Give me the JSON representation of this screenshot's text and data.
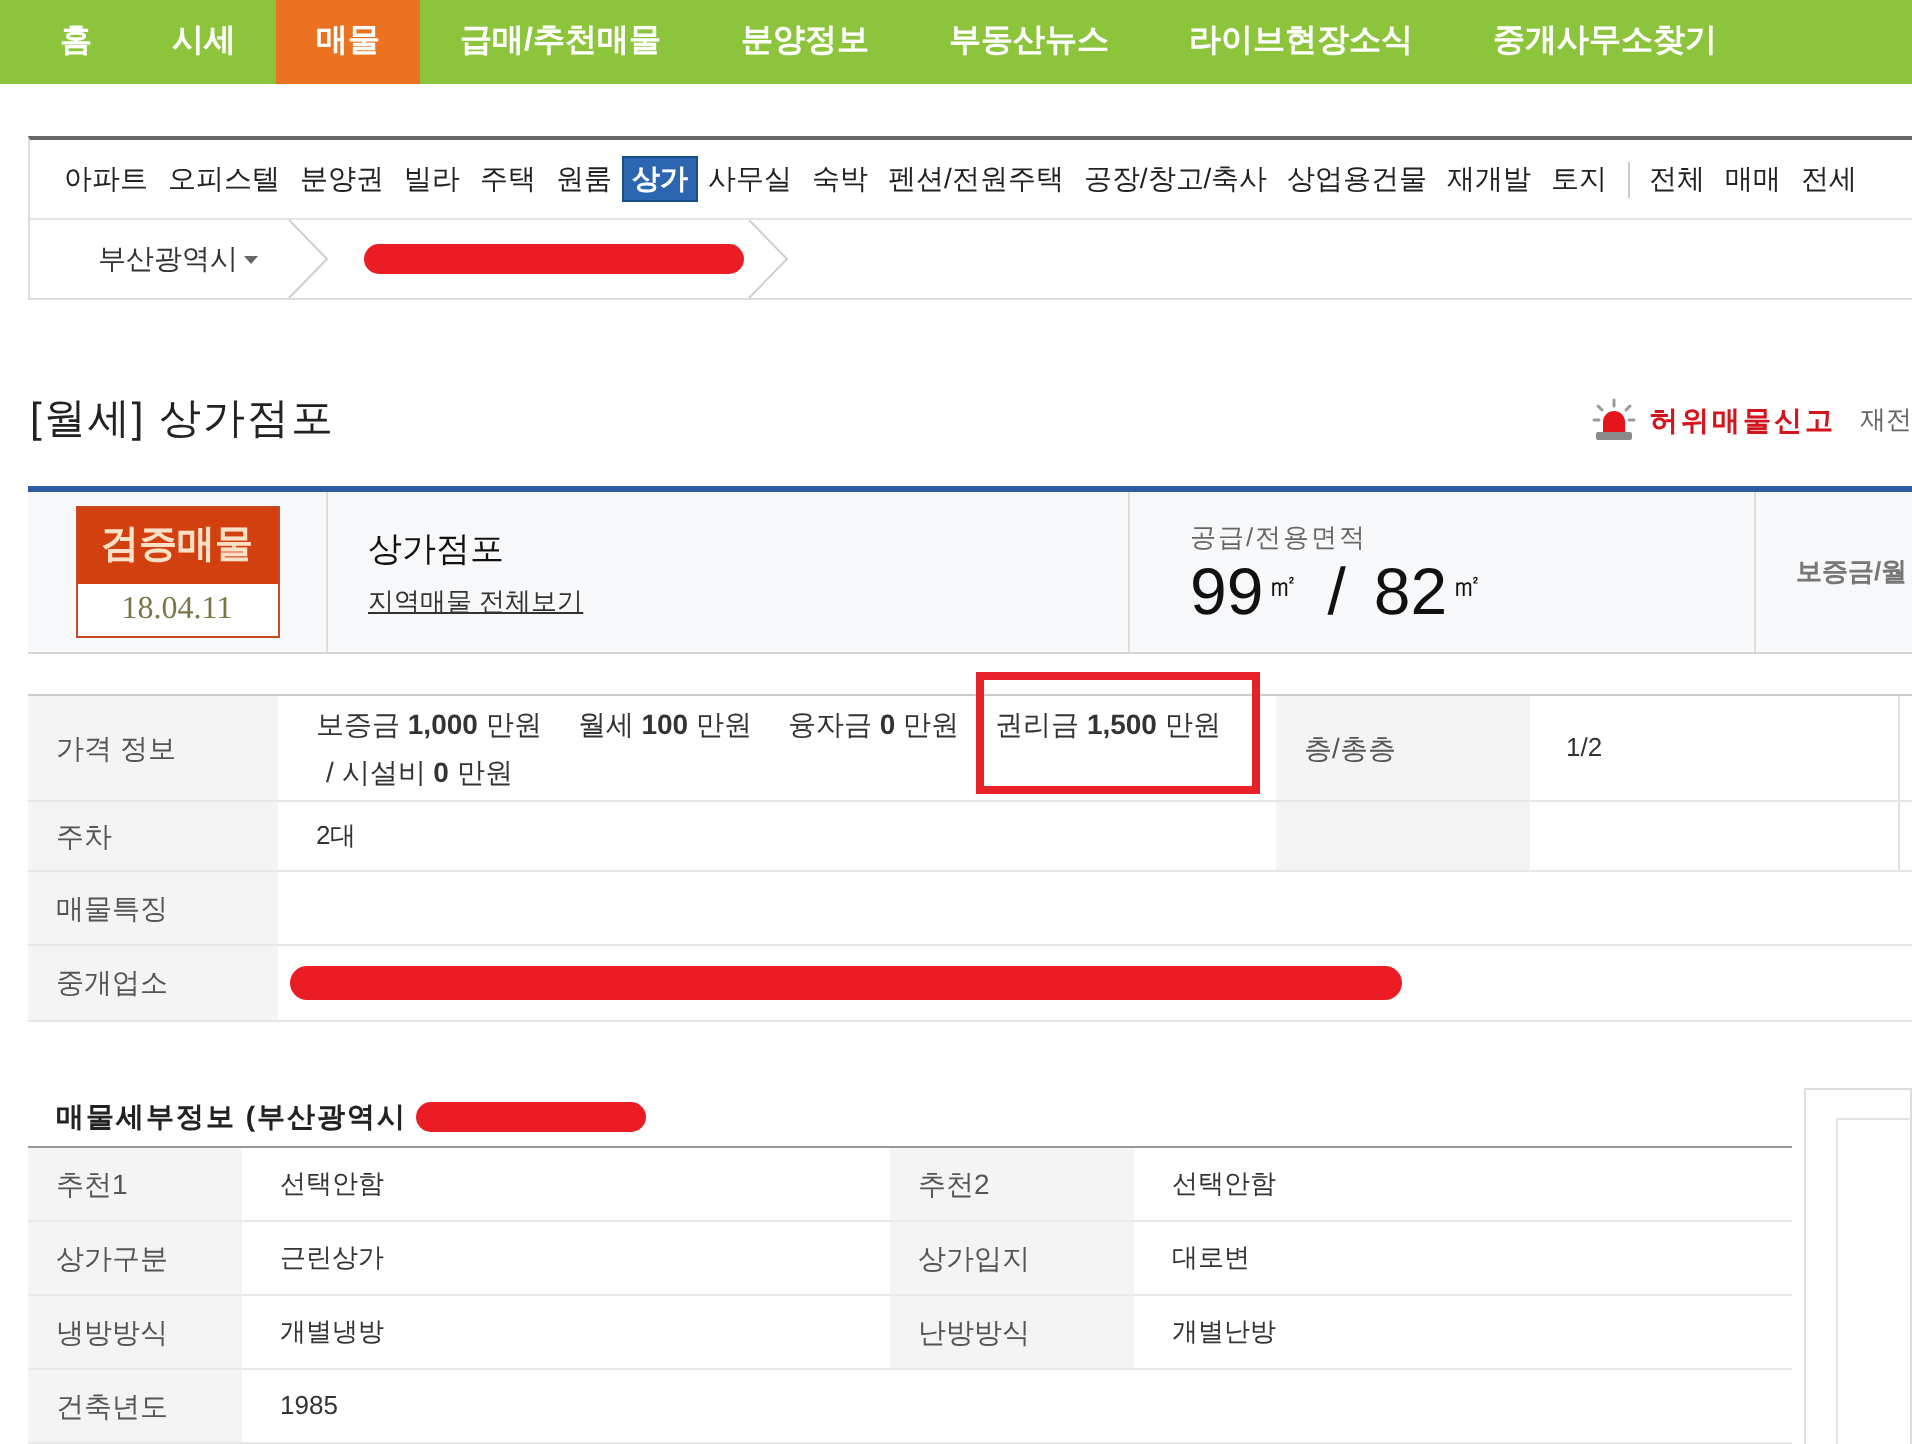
{
  "top_nav": {
    "items": [
      {
        "label": "홈",
        "selected": false
      },
      {
        "label": "시세",
        "selected": false
      },
      {
        "label": "매물",
        "selected": true
      },
      {
        "label": "급매/추천매물",
        "selected": false
      },
      {
        "label": "분양정보",
        "selected": false
      },
      {
        "label": "부동산뉴스",
        "selected": false
      },
      {
        "label": "라이브현장소식",
        "selected": false
      },
      {
        "label": "중개사무소찾기",
        "selected": false
      }
    ]
  },
  "category_bar": {
    "property_types": [
      {
        "label": "아파트",
        "selected": false
      },
      {
        "label": "오피스텔",
        "selected": false
      },
      {
        "label": "분양권",
        "selected": false
      },
      {
        "label": "빌라",
        "selected": false
      },
      {
        "label": "주택",
        "selected": false
      },
      {
        "label": "원룸",
        "selected": false
      },
      {
        "label": "상가",
        "selected": true
      },
      {
        "label": "사무실",
        "selected": false
      },
      {
        "label": "숙박",
        "selected": false
      },
      {
        "label": "펜션/전원주택",
        "selected": false
      },
      {
        "label": "공장/창고/축사",
        "selected": false
      },
      {
        "label": "상업용건물",
        "selected": false
      },
      {
        "label": "재개발",
        "selected": false
      },
      {
        "label": "토지",
        "selected": false
      }
    ],
    "deal_types": [
      {
        "label": "전체",
        "selected": false
      },
      {
        "label": "매매",
        "selected": false
      },
      {
        "label": "전세",
        "selected": false
      }
    ]
  },
  "breadcrumb": {
    "items": [
      {
        "kind": "region",
        "label": "부산광역시",
        "dropdown": true
      },
      {
        "kind": "redacted"
      }
    ]
  },
  "listing": {
    "title": "[월세] 상가점포",
    "report_link": "허위매물신고",
    "side_link": "재전"
  },
  "summary": {
    "badge": {
      "label": "검증매물",
      "date": "18.04.11"
    },
    "name": "상가점포",
    "link": "지역매물 전체보기",
    "area": {
      "label": "공급/전용면적",
      "values": [
        {
          "number": "99",
          "unit": "㎡"
        },
        {
          "number": "82",
          "unit": "㎡"
        }
      ],
      "separator": "/"
    },
    "price_label": "보증금/월"
  },
  "info_table": {
    "rows": [
      {
        "label": "가격 정보",
        "kind": "price",
        "lines": [
          [
            {
              "text": "보증금 **1,000** 만원",
              "highlighted": false
            },
            {
              "text": "월세 **100** 만원",
              "highlighted": false
            },
            {
              "text": "융자금 **0** 만원",
              "highlighted": false
            },
            {
              "text": "권리금 **1,500** 만원",
              "highlighted": true
            }
          ],
          [
            {
              "text": "/ 시설비 **0** 만원",
              "highlighted": false
            }
          ]
        ],
        "side_label": "층/총층",
        "side_value": "1/2"
      },
      {
        "label": "주차",
        "kind": "split",
        "value": "2대"
      },
      {
        "label": "매물특징",
        "kind": "full"
      },
      {
        "label": "중개업소",
        "kind": "redacted"
      }
    ]
  },
  "detail": {
    "title": "매물세부정보 (부산광역시",
    "redacted": true,
    "rows": [
      {
        "cells": [
          {
            "label": "추천1",
            "value": "선택안함"
          },
          {
            "label": "추천2",
            "value": "선택안함"
          }
        ]
      },
      {
        "cells": [
          {
            "label": "상가구분",
            "value": "근린상가"
          },
          {
            "label": "상가입지",
            "value": "대로변"
          }
        ]
      },
      {
        "cells": [
          {
            "label": "냉방방식",
            "value": "개별냉방"
          },
          {
            "label": "난방방식",
            "value": "개별난방"
          }
        ]
      },
      {
        "cells": [
          {
            "label": "건축년도",
            "value": "1985"
          }
        ]
      }
    ]
  }
}
